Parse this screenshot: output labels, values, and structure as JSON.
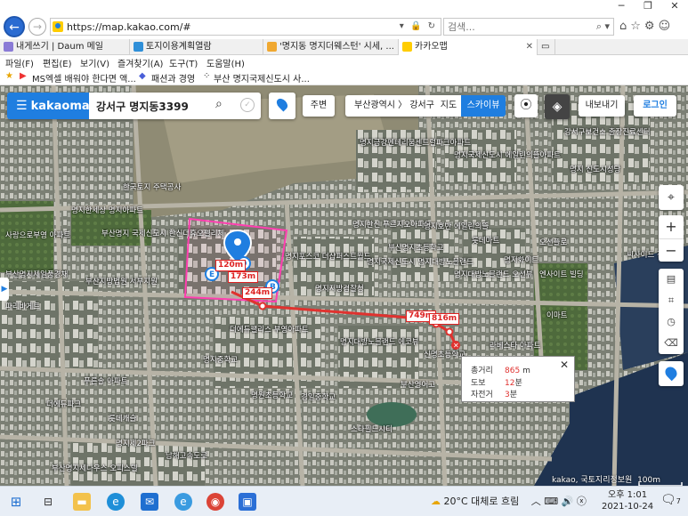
{
  "browser": {
    "url": "https://map.kakao.com/#",
    "search_placeholder": "검색...",
    "tabs": [
      {
        "label": "내게쓰기 | Daum 메일",
        "active": false,
        "color": "#8a7bd6"
      },
      {
        "label": "토지이용계획열람",
        "active": false,
        "color": "#2f8fd8"
      },
      {
        "label": "'명지동 명지더웨스턴' 시세, ...",
        "active": false,
        "color": "#f0a830"
      },
      {
        "label": "카카오맵",
        "active": true,
        "color": "#ffcd00"
      }
    ],
    "menu": [
      "파일(F)",
      "편집(E)",
      "보기(V)",
      "즐겨찾기(A)",
      "도구(T)",
      "도움말(H)"
    ],
    "favorites": [
      "MS엑셀 배워야 한다면 액...",
      "패션과 경영",
      "부산 명지국제신도시 사..."
    ]
  },
  "kakaomap": {
    "logo": "kakaomap",
    "search_query": "강서구 명지동3399",
    "nearby_label": "주변",
    "breadcrumb": "부산광역시 〉 강서구",
    "map_tab": "지도",
    "skyview_tab": "스카이뷰",
    "share_label": "내보내기",
    "login_label": "로그인",
    "icons": [
      "menu-icon",
      "search-icon",
      "clear-icon",
      "pin-icon",
      "roadview-icon",
      "layers-icon",
      "location-icon",
      "zoom-in-icon",
      "zoom-out-icon",
      "ruler-icon",
      "area-icon",
      "radius-icon",
      "eraser-icon"
    ]
  },
  "measurement": {
    "total_label": "총거리",
    "total_value": "865",
    "total_unit": "m",
    "walk_label": "도보",
    "walk_value": "12",
    "walk_unit": "분",
    "bike_label": "자전거",
    "bike_value": "3",
    "bike_unit": "분",
    "segments": [
      "120m",
      "173m",
      "244m",
      "749m",
      "816m"
    ],
    "route_color": "#e0322f"
  },
  "map_labels": [
    "명지금강펜테리움센트럴파크아파트",
    "명지국제신도시 에일린의뜰아파트",
    "강서구보건소 출장진료센터",
    "명지 신도시성당",
    "한국토지 주택공사",
    "명지한세상 명지아파트",
    "사랑으로부영 아파트",
    "부산명지 국제신도시 한신더휴오펠리체",
    "명지포스코 더샵퍼스트월드",
    "명지한신 푸르지오아파트",
    "부산명지초등학교",
    "명지국제신도시 명지대방노블랜드",
    "명지호반 에일린의뜰",
    "롯데마트",
    "오션플로",
    "부산지방법원 서부지원",
    "명지대방노블랜드 오션뷰",
    "이마트",
    "명지지방검찰청",
    "더에듀팰리스 부영아파트",
    "명지대방노블랜드 에코뷰",
    "신명초등학교",
    "명원초등학교",
    "경일중학교",
    "명지중학교",
    "부산영어고",
    "라베스타 아파트",
    "씨사이드 전망대",
    "스타필드시티",
    "더에듀파크",
    "롯데캐슬",
    "부산명지세나우스 오피스텔",
    "명지제2파크",
    "파리바게트",
    "남해고속도로",
    "부산명지제일풍경채",
    "푸른솔 아파트",
    "엔사이트 빌딩",
    "명지화이트"
  ],
  "copyright": "kakao, 국토지리정보원",
  "scale_label": "100m",
  "taskbar": {
    "weather": "20°C 대체로 흐림",
    "time": "오후 1:01",
    "date": "2021-10-24",
    "notification_count": "7"
  }
}
